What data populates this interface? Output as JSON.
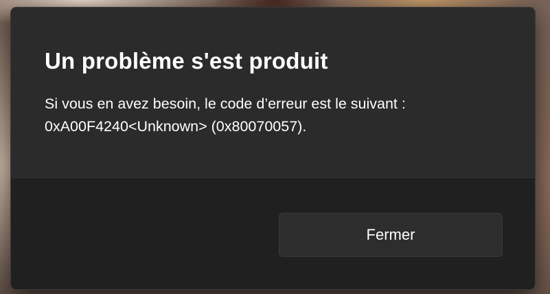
{
  "dialog": {
    "title": "Un problème s'est produit",
    "message_line1": "Si vous en avez besoin, le code d’erreur est le suivant :",
    "message_line2": "0xA00F4240<Unknown> (0x80070057).",
    "close_label": "Fermer"
  },
  "colors": {
    "content_bg": "#2b2b2b",
    "footer_bg": "#202020",
    "button_bg": "#2d2d2d",
    "text": "#ffffff"
  }
}
